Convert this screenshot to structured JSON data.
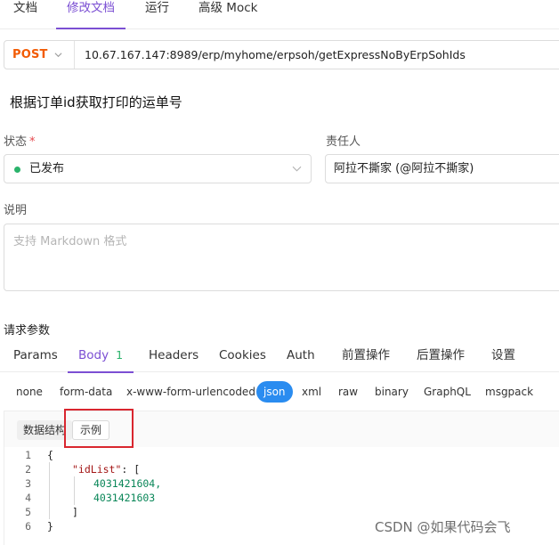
{
  "top_tabs": [
    {
      "label": "文档",
      "active": false
    },
    {
      "label": "修改文档",
      "active": true
    },
    {
      "label": "运行",
      "active": false
    },
    {
      "label": "高级 Mock",
      "active": false
    }
  ],
  "request": {
    "method": "POST",
    "url": "10.67.167.147:8989/erp/myhome/erpsoh/getExpressNoByErpSohIds"
  },
  "api_title": "根据订单id获取打印的运单号",
  "status_field": {
    "label": "状态",
    "required_mark": "*",
    "value": "已发布",
    "dot_color": "#2ab36b"
  },
  "owner_field": {
    "label": "责任人",
    "value": "阿拉不撕家 (@阿拉不撕家)"
  },
  "description_field": {
    "label": "说明",
    "placeholder": "支持 Markdown 格式"
  },
  "request_params": {
    "title": "请求参数",
    "tabs": [
      {
        "label": "Params",
        "active": false
      },
      {
        "label": "Body",
        "badge": "1",
        "active": true
      },
      {
        "label": "Headers",
        "active": false
      },
      {
        "label": "Cookies",
        "active": false
      },
      {
        "label": "Auth",
        "active": false
      },
      {
        "label": "前置操作",
        "active": false
      },
      {
        "label": "后置操作",
        "active": false
      },
      {
        "label": "设置",
        "active": false
      }
    ],
    "body_types": [
      "none",
      "form-data",
      "x-www-form-urlencoded",
      "json",
      "xml",
      "raw",
      "binary",
      "GraphQL",
      "msgpack"
    ],
    "body_type_selected": "json",
    "editor": {
      "modes": [
        "数据结构",
        "示例"
      ],
      "active_mode": "示例",
      "line_numbers": [
        "1",
        "2",
        "3",
        "4",
        "5",
        "6"
      ],
      "code": {
        "open_brace": "{",
        "key": "\"idList\"",
        "colon_bracket": ": [",
        "values": [
          "4031421604,",
          "4031421603"
        ],
        "close_bracket": "]",
        "close_brace": "}"
      }
    }
  },
  "accent_color": "#7b4fd3",
  "method_color": "#f25c05",
  "watermark": "CSDN @如果代码会飞"
}
